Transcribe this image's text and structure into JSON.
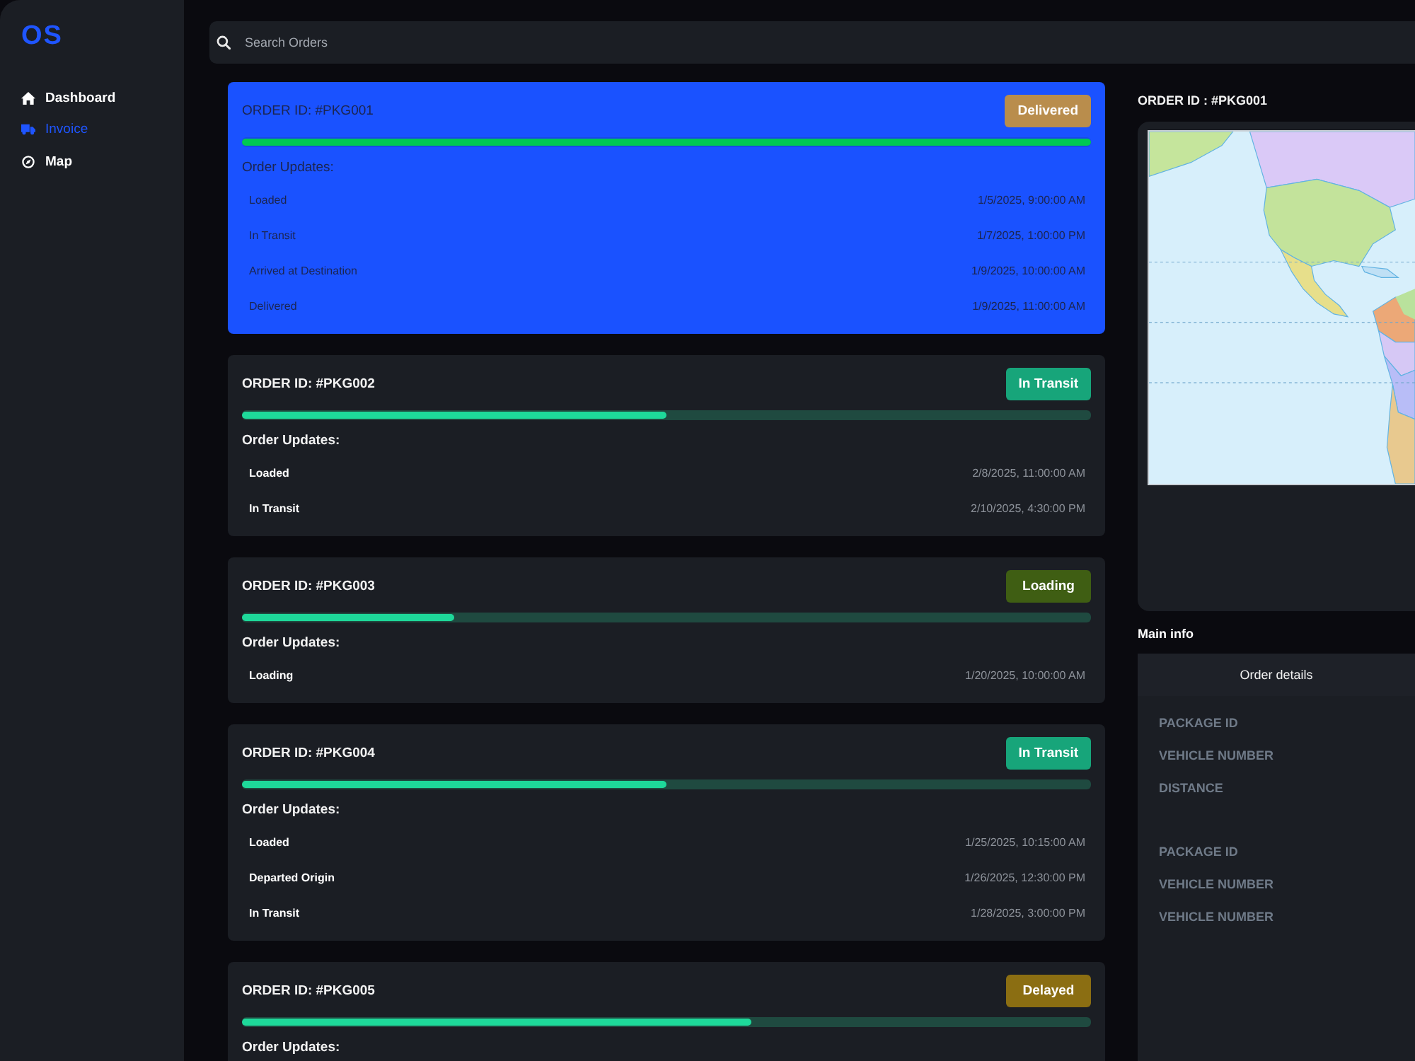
{
  "sidebar": {
    "logo": "OS",
    "items": [
      {
        "label": "Dashboard",
        "selected": false
      },
      {
        "label": "Invoice",
        "selected": true
      },
      {
        "label": "Map",
        "selected": false
      }
    ]
  },
  "search": {
    "placeholder": "Search Orders"
  },
  "orders": [
    {
      "order_id": "ORDER ID: #PKG001",
      "status": "Delivered",
      "color": "#b98d4c",
      "level": 1,
      "selected": true,
      "updates_title": "Order Updates:",
      "updates": [
        {
          "event": "Loaded",
          "time": "1/5/2025, 9:00:00 AM"
        },
        {
          "event": "In Transit",
          "time": "1/7/2025, 1:00:00 PM"
        },
        {
          "event": "Arrived at Destination",
          "time": "1/9/2025, 10:00:00 AM"
        },
        {
          "event": "Delivered",
          "time": "1/9/2025, 11:00:00 AM"
        }
      ]
    },
    {
      "order_id": "ORDER ID: #PKG002",
      "status": "In Transit",
      "color": "#17a57a",
      "level": 0.5,
      "selected": false,
      "updates_title": "Order Updates:",
      "updates": [
        {
          "event": "Loaded",
          "time": "2/8/2025, 11:00:00 AM"
        },
        {
          "event": "In Transit",
          "time": "2/10/2025, 4:30:00 PM"
        }
      ]
    },
    {
      "order_id": "ORDER ID: #PKG003",
      "status": "Loading",
      "color": "#3f5e13",
      "level": 0.25,
      "selected": false,
      "updates_title": "Order Updates:",
      "updates": [
        {
          "event": "Loading",
          "time": "1/20/2025, 10:00:00 AM"
        }
      ]
    },
    {
      "order_id": "ORDER ID: #PKG004",
      "status": "In Transit",
      "color": "#17a57a",
      "level": 0.5,
      "selected": false,
      "updates_title": "Order Updates:",
      "updates": [
        {
          "event": "Loaded",
          "time": "1/25/2025, 10:15:00 AM"
        },
        {
          "event": "Departed Origin",
          "time": "1/26/2025, 12:30:00 PM"
        },
        {
          "event": "In Transit",
          "time": "1/28/2025, 3:00:00 PM"
        }
      ]
    },
    {
      "order_id": "ORDER ID: #PKG005",
      "status": "Delayed",
      "color": "#8b6e12",
      "level": 0.6,
      "selected": false,
      "updates_title": "Order Updates:"
    }
  ],
  "detail": {
    "title": "ORDER ID : #PKG001"
  },
  "main_info": {
    "title": "Main info",
    "card_title": "Order details",
    "field_groups": [
      [
        "PACKAGE ID",
        "VEHICLE NUMBER",
        "DISTANCE"
      ],
      [
        "PACKAGE ID",
        "VEHICLE NUMBER",
        "VEHICLE NUMBER"
      ]
    ]
  }
}
